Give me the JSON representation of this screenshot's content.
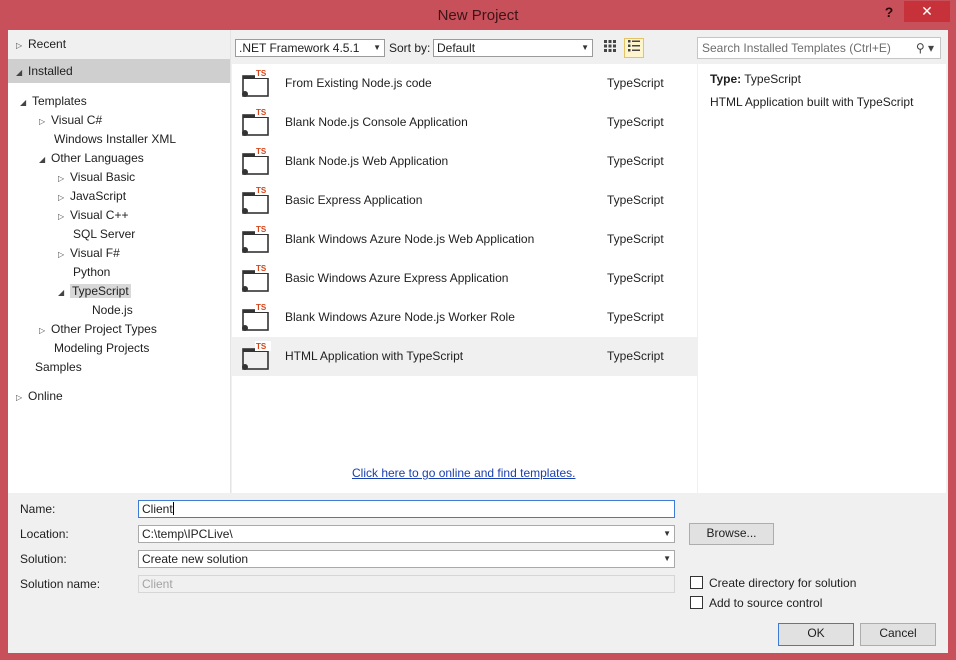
{
  "window": {
    "title": "New Project",
    "help": "?",
    "close": "✕"
  },
  "tree": {
    "recent": "Recent",
    "installed": "Installed",
    "templates": "Templates",
    "visual_csharp": "Visual C#",
    "windows_installer_xml": "Windows Installer XML",
    "other_languages": "Other Languages",
    "visual_basic": "Visual Basic",
    "javascript": "JavaScript",
    "visual_cpp": "Visual C++",
    "sql_server": "SQL Server",
    "visual_fsharp": "Visual F#",
    "python": "Python",
    "typescript": "TypeScript",
    "nodejs": "Node.js",
    "other_project_types": "Other Project Types",
    "modeling_projects": "Modeling Projects",
    "samples": "Samples",
    "online": "Online"
  },
  "toolbar": {
    "framework": ".NET Framework 4.5.1",
    "sort_label": "Sort by:",
    "sort_value": "Default",
    "search_placeholder": "Search Installed Templates (Ctrl+E)"
  },
  "templates": [
    {
      "name": "From Existing Node.js code",
      "lang": "TypeScript"
    },
    {
      "name": "Blank Node.js Console Application",
      "lang": "TypeScript"
    },
    {
      "name": "Blank Node.js Web Application",
      "lang": "TypeScript"
    },
    {
      "name": "Basic Express Application",
      "lang": "TypeScript"
    },
    {
      "name": "Blank Windows Azure Node.js Web Application",
      "lang": "TypeScript"
    },
    {
      "name": "Basic Windows Azure Express Application",
      "lang": "TypeScript"
    },
    {
      "name": "Blank Windows Azure Node.js Worker Role",
      "lang": "TypeScript"
    },
    {
      "name": "HTML Application with TypeScript",
      "lang": "TypeScript"
    }
  ],
  "icon_badge": "TS",
  "online_link": "Click here to go online and find templates.",
  "detail": {
    "type_label": "Type:",
    "type_value": "TypeScript",
    "description": "HTML Application built with TypeScript"
  },
  "form": {
    "name_label": "Name:",
    "name_value": "Client",
    "location_label": "Location:",
    "location_value": "C:\\temp\\IPCLive\\",
    "solution_label": "Solution:",
    "solution_value": "Create new solution",
    "solution_name_label": "Solution name:",
    "solution_name_value": "Client",
    "browse": "Browse...",
    "create_directory": "Create directory for solution",
    "add_source_control": "Add to source control",
    "ok": "OK",
    "cancel": "Cancel"
  }
}
